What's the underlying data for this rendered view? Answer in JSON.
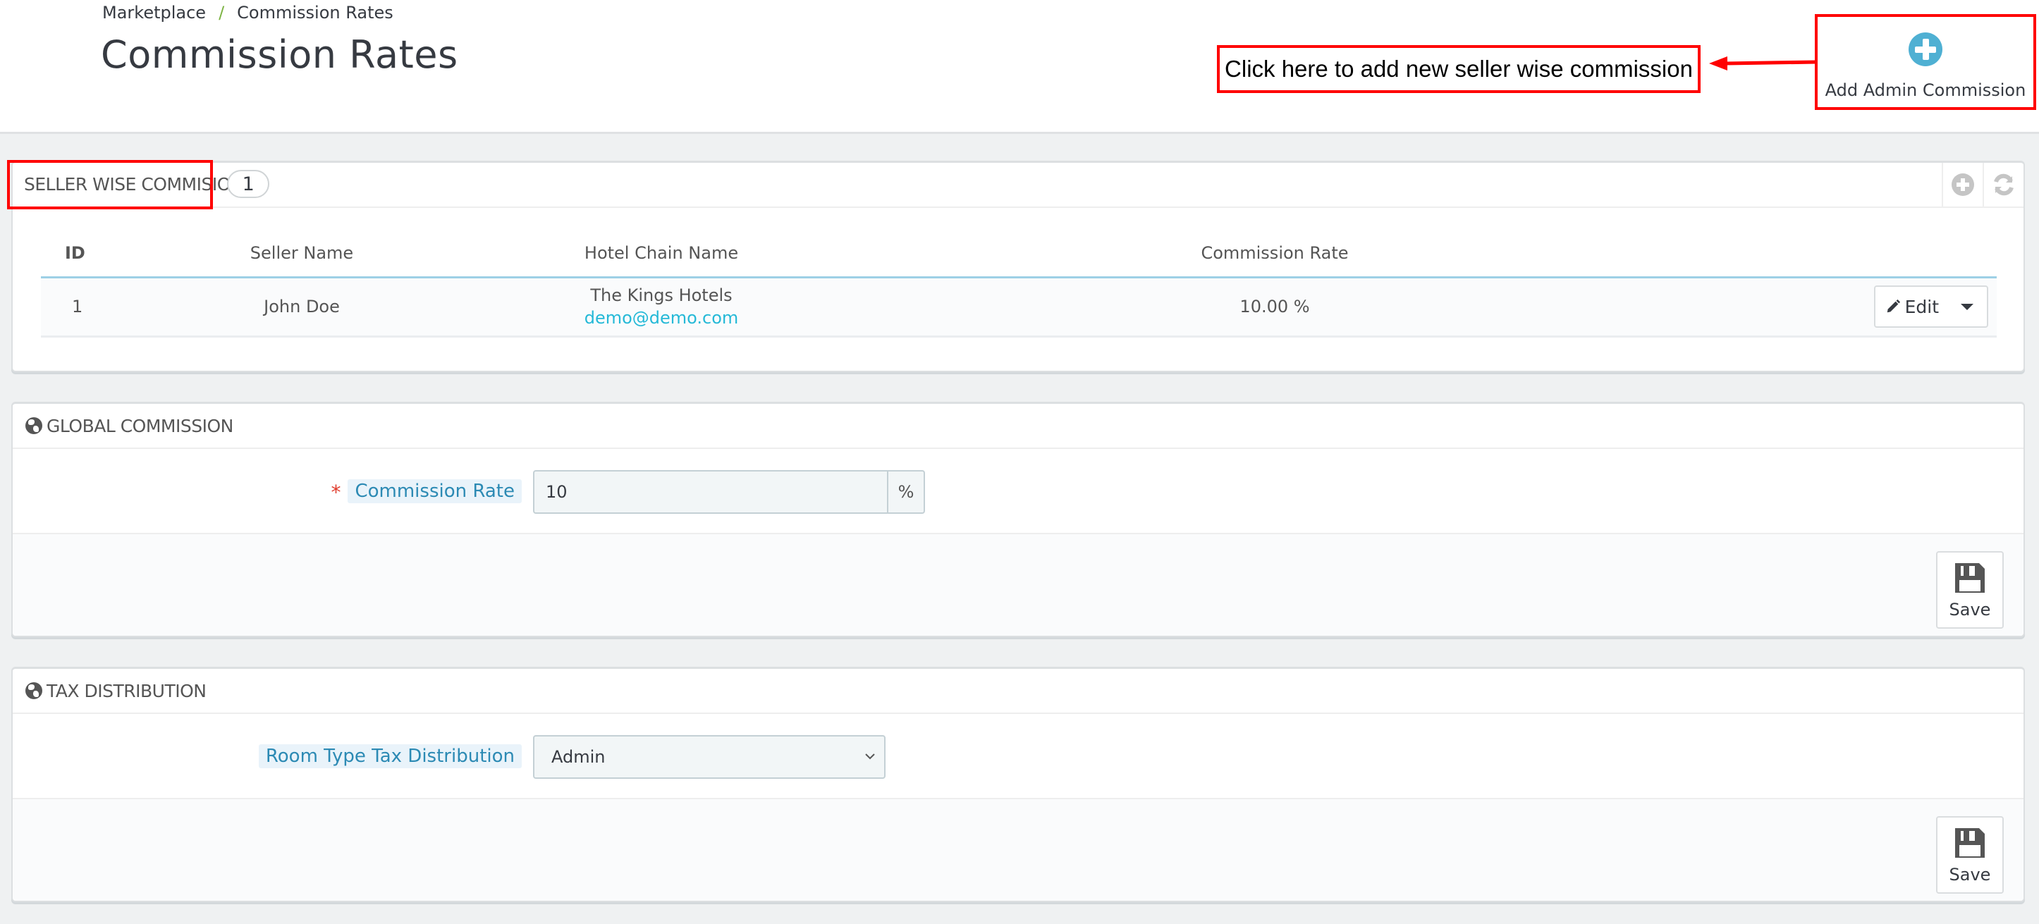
{
  "header": {
    "breadcrumb": [
      {
        "label": "Marketplace"
      },
      {
        "label": "Commission Rates"
      }
    ],
    "breadcrumb_separator": "/",
    "title": "Commission Rates",
    "annotation_text": "Click here to add new seller wise commission",
    "add_admin_button": {
      "label": "Add Admin Commission",
      "icon": "plus-circle-icon"
    }
  },
  "seller_panel": {
    "title": "SELLER WISE COMMISION",
    "count": "1",
    "tools": [
      {
        "name": "add-new",
        "icon": "plus-circle-icon"
      },
      {
        "name": "refresh",
        "icon": "refresh-icon"
      }
    ],
    "columns": [
      "ID",
      "Seller Name",
      "Hotel Chain Name",
      "Commission Rate",
      ""
    ],
    "rows": [
      {
        "id": "1",
        "seller_name": "John Doe",
        "hotel_chain_name": "The Kings Hotels",
        "email": "demo@demo.com",
        "commission_rate": "10.00 %",
        "action_label": "Edit"
      }
    ]
  },
  "global_panel": {
    "title": "GLOBAL COMMISSION",
    "field_label": "Commission Rate",
    "required_marker": "*",
    "value": "10",
    "addon": "%",
    "save_label": "Save"
  },
  "tax_panel": {
    "title": "TAX DISTRIBUTION",
    "field_label": "Room Type Tax Distribution",
    "selected": "Admin",
    "save_label": "Save"
  },
  "colors": {
    "accent": "#25b9d7",
    "annotation": "#ff0000",
    "label_bg": "#e9f3fa",
    "required": "#e03b2c"
  }
}
